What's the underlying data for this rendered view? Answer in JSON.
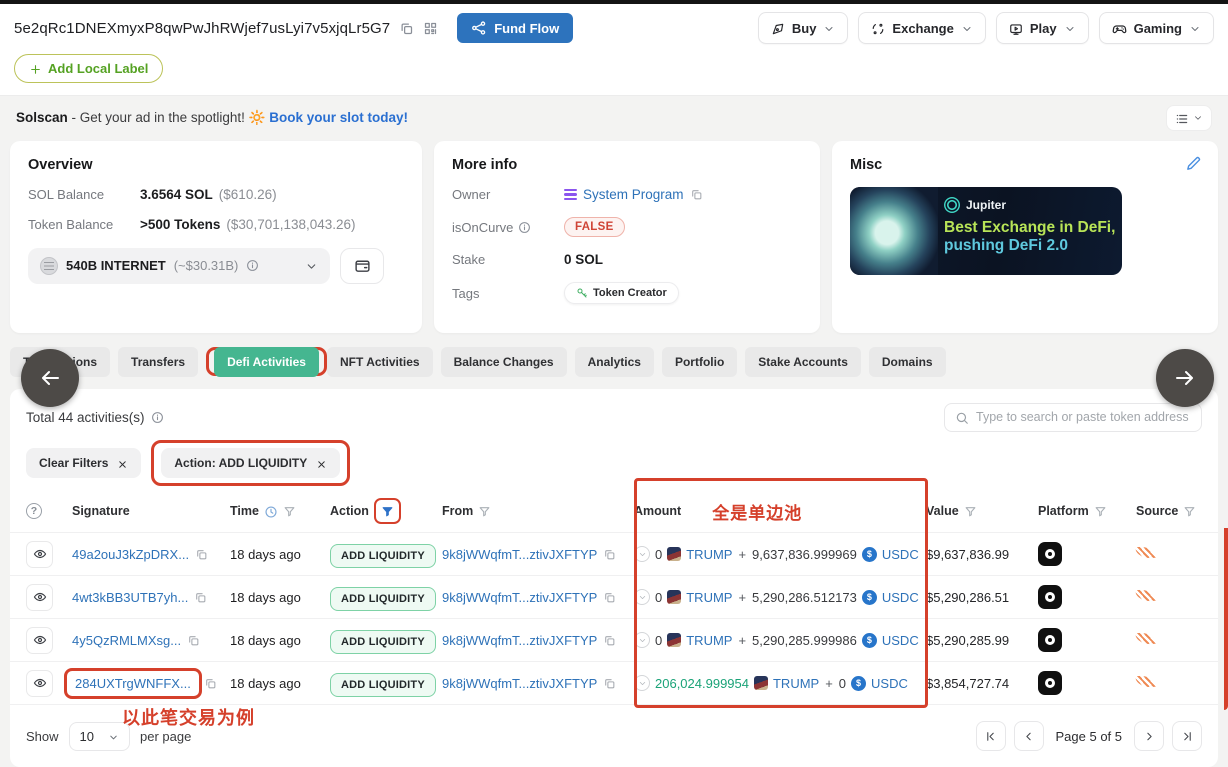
{
  "header": {
    "address": "5e2qRc1DNEXmyxP8qwPwJhRWjef7usLyi7v5xjqLr5G7",
    "fund_flow": "Fund Flow",
    "nav": [
      {
        "label": "Buy"
      },
      {
        "label": "Exchange"
      },
      {
        "label": "Play"
      },
      {
        "label": "Gaming"
      }
    ],
    "add_local_label": "Add Local Label"
  },
  "ad_bar": {
    "brand": "Solscan",
    "text": "- Get your ad in the spotlight!",
    "emoji": "🔆",
    "link": "Book your slot today!"
  },
  "overview": {
    "title": "Overview",
    "sol_balance_label": "SOL Balance",
    "sol_balance_value": "3.6564 SOL",
    "sol_balance_usd": "($610.26)",
    "token_balance_label": "Token Balance",
    "token_balance_value": ">500 Tokens",
    "token_balance_usd": "($30,701,138,043.26)",
    "token_selector_value": "540B INTERNET",
    "token_selector_usd": "(~$30.31B)"
  },
  "more_info": {
    "title": "More info",
    "owner_label": "Owner",
    "owner_value": "System Program",
    "isoncurve_label": "isOnCurve",
    "isoncurve_value": "FALSE",
    "stake_label": "Stake",
    "stake_value": "0 SOL",
    "tags_label": "Tags",
    "tag_value": "Token Creator"
  },
  "misc": {
    "title": "Misc",
    "banner_brand": "Jupiter",
    "banner_line1": "Best Exchange in DeFi,",
    "banner_line2": "pushing DeFi 2.0"
  },
  "tabs": {
    "items": [
      "Transactions",
      "Transfers",
      "Defi Activities",
      "NFT Activities",
      "Balance Changes",
      "Analytics",
      "Portfolio",
      "Stake Accounts",
      "Domains"
    ],
    "active": "Defi Activities"
  },
  "activities": {
    "total": "Total 44 activities(s)",
    "search_placeholder": "Type to search or paste token address",
    "chip_clear": "Clear Filters",
    "chip_action": "Action: ADD LIQUIDITY",
    "annotation_amount": "全是单边池",
    "annotation_row": "以此笔交易为例",
    "table": {
      "headers": {
        "signature": "Signature",
        "time": "Time",
        "action": "Action",
        "from": "From",
        "amount": "Amount",
        "value": "Value",
        "platform": "Platform",
        "source": "Source"
      },
      "rows": [
        {
          "sig": "49a2ouJ3kZpDRX...",
          "time": "18 days ago",
          "action": "ADD LIQUIDITY",
          "from": "9k8jWWqfmT...ztivJXFTYP",
          "a1": "0",
          "t1": "TRUMP",
          "a2": "9,637,836.999969",
          "t2": "USDC",
          "a1_green": false,
          "a2_green": false,
          "value": "$9,637,836.99",
          "highlight": false
        },
        {
          "sig": "4wt3kBB3UTB7yh...",
          "time": "18 days ago",
          "action": "ADD LIQUIDITY",
          "from": "9k8jWWqfmT...ztivJXFTYP",
          "a1": "0",
          "t1": "TRUMP",
          "a2": "5,290,286.512173",
          "t2": "USDC",
          "a1_green": false,
          "a2_green": false,
          "value": "$5,290,286.51",
          "highlight": false
        },
        {
          "sig": "4y5QzRMLMXsg...",
          "time": "18 days ago",
          "action": "ADD LIQUIDITY",
          "from": "9k8jWWqfmT...ztivJXFTYP",
          "a1": "0",
          "t1": "TRUMP",
          "a2": "5,290,285.999986",
          "t2": "USDC",
          "a1_green": false,
          "a2_green": false,
          "value": "$5,290,285.99",
          "highlight": false
        },
        {
          "sig": "284UXTrgWNFFX...",
          "time": "18 days ago",
          "action": "ADD LIQUIDITY",
          "from": "9k8jWWqfmT...ztivJXFTYP",
          "a1": "206,024.999954",
          "t1": "TRUMP",
          "a2": "0",
          "t2": "USDC",
          "a1_green": true,
          "a2_green": false,
          "value": "$3,854,727.74",
          "highlight": true
        }
      ]
    },
    "footer": {
      "show": "Show",
      "page_size": "10",
      "per_page": "per page",
      "page_info": "Page 5 of 5"
    }
  },
  "colors": {
    "accent_blue": "#2e72b8",
    "fund_flow_blue": "#2d73bd",
    "active_tab_green": "#45b690",
    "annotation_red": "#d5402b",
    "amount_green": "#1ba378",
    "usdc_blue": "#2775ca",
    "false_badge_red": "#cf4436"
  }
}
